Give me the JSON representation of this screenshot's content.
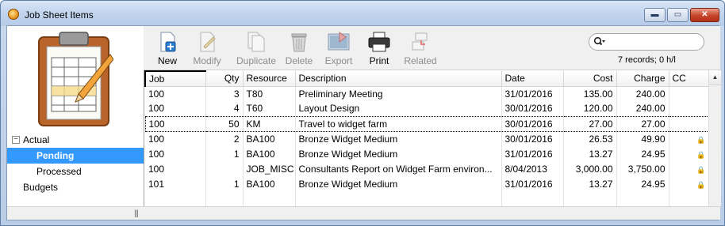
{
  "window": {
    "title": "Job Sheet Items",
    "buttons": {
      "minimize": "▬",
      "maximize": "▭",
      "close": "✕"
    }
  },
  "sidebar": {
    "tree": [
      {
        "label": "Actual",
        "expander": "−"
      },
      {
        "label": "Pending",
        "selected": true
      },
      {
        "label": "Processed"
      },
      {
        "label": "Budgets"
      }
    ]
  },
  "toolbar": {
    "buttons": [
      {
        "label": "New",
        "icon": "new-document-icon",
        "enabled": true
      },
      {
        "label": "Modify",
        "icon": "modify-document-icon",
        "enabled": false
      },
      {
        "label": "Duplicate",
        "icon": "duplicate-icon",
        "enabled": false
      },
      {
        "label": "Delete",
        "icon": "trash-icon",
        "enabled": false
      },
      {
        "label": "Export",
        "icon": "export-icon",
        "enabled": false
      },
      {
        "label": "Print",
        "icon": "printer-icon",
        "enabled": true
      },
      {
        "label": "Related",
        "icon": "related-icon",
        "enabled": false
      }
    ],
    "search": {
      "value": "",
      "placeholder": ""
    },
    "record_count": "7 records; 0 h/l"
  },
  "grid": {
    "columns": [
      "Job",
      "Qty",
      "Resource",
      "Description",
      "Date",
      "Cost",
      "Charge",
      "CC"
    ],
    "rows": [
      {
        "job": "100",
        "qty": "3",
        "resource": "T80",
        "description": "Preliminary Meeting",
        "date": "31/01/2016",
        "cost": "135.00",
        "charge": "240.00",
        "cc": ""
      },
      {
        "job": "100",
        "qty": "4",
        "resource": "T60",
        "description": "Layout Design",
        "date": "30/01/2016",
        "cost": "120.00",
        "charge": "240.00",
        "cc": ""
      },
      {
        "job": "100",
        "qty": "50",
        "resource": "KM",
        "description": "Travel to widget farm",
        "date": "30/01/2016",
        "cost": "27.00",
        "charge": "27.00",
        "cc": ""
      },
      {
        "job": "100",
        "qty": "2",
        "resource": "BA100",
        "description": "Bronze Widget Medium",
        "date": "30/01/2016",
        "cost": "26.53",
        "charge": "49.90",
        "cc": "lock-icon"
      },
      {
        "job": "100",
        "qty": "1",
        "resource": "BA100",
        "description": "Bronze Widget Medium",
        "date": "31/01/2016",
        "cost": "13.27",
        "charge": "24.95",
        "cc": "lock-icon"
      },
      {
        "job": "100",
        "qty": "",
        "resource": "JOB_MISC",
        "description": "Consultants Report on Widget Farm environ...",
        "date": "8/04/2013",
        "cost": "3,000.00",
        "charge": "3,750.00",
        "cc": "lock-icon"
      },
      {
        "job": "101",
        "qty": "1",
        "resource": "BA100",
        "description": "Bronze Widget Medium",
        "date": "31/01/2016",
        "cost": "13.27",
        "charge": "24.95",
        "cc": "lock-icon"
      }
    ],
    "focused_row": 2
  },
  "colors": {
    "selection": "#3399ff",
    "title_bar": "#c2d5ee",
    "close_button": "#c6442a"
  }
}
